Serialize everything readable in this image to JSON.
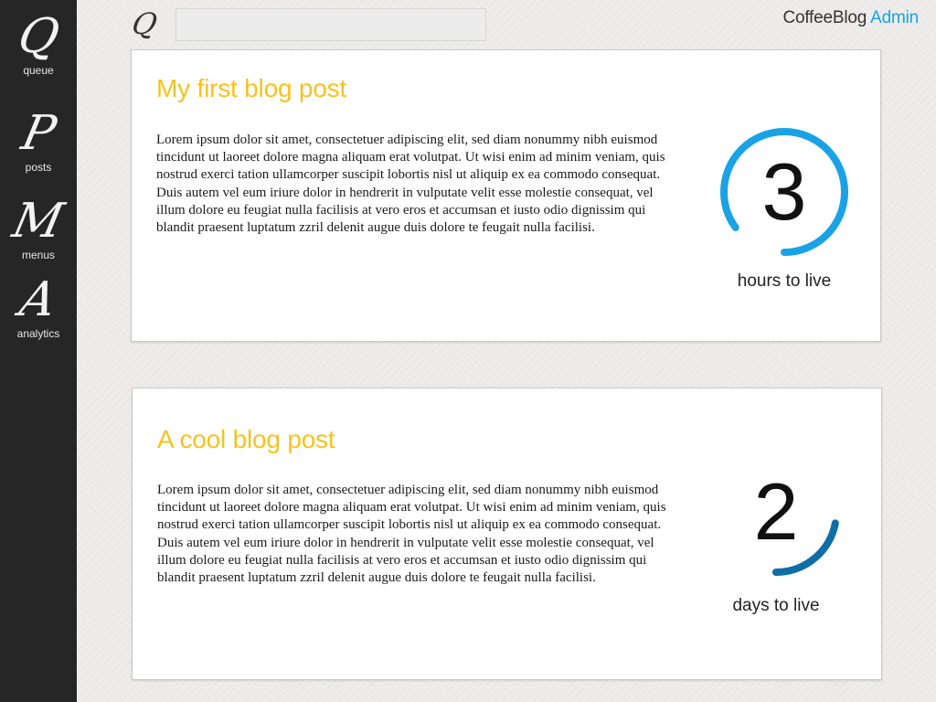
{
  "sidebar": {
    "items": [
      {
        "glyph": "Q",
        "label": "queue"
      },
      {
        "glyph": "P",
        "label": "posts"
      },
      {
        "glyph": "M",
        "label": "menus"
      },
      {
        "glyph": "A",
        "label": "analytics"
      }
    ]
  },
  "header": {
    "search_icon_glyph": "Q",
    "search_value": "",
    "brand_name": "CoffeeBlog",
    "brand_role": "Admin"
  },
  "posts": [
    {
      "title": "My first blog post",
      "body": "Lorem ipsum dolor sit amet, consectetuer adipiscing elit, sed diam nonummy nibh euismod tincidunt ut laoreet dolore magna aliquam erat volutpat. Ut wisi enim ad minim veniam, quis nostrud exerci tation ullamcorper suscipit lobortis nisl ut aliquip ex ea commodo consequat. Duis autem vel eum iriure dolor in hendrerit in vulputate velit esse molestie consequat, vel illum dolore eu feugiat nulla facilisis at vero eros et accumsan et iusto odio dignissim qui blandit praesent luptatum zzril delenit augue duis dolore te feugait nulla facilisi.",
      "countdown_value": "3",
      "countdown_caption": "hours to live",
      "ring_fraction": 0.85,
      "ring_color": "#1aa2e6"
    },
    {
      "title": "A cool blog post",
      "body": "Lorem ipsum dolor sit amet, consectetuer adipiscing elit, sed diam nonummy nibh euismod tincidunt ut laoreet dolore magna aliquam erat volutpat. Ut wisi enim ad minim veniam, quis nostrud exerci tation ullamcorper suscipit lobortis nisl ut aliquip ex ea commodo consequat. Duis autem vel eum iriure dolor in hendrerit in vulputate velit esse molestie consequat, vel illum dolore eu feugiat nulla facilisis at vero eros et accumsan et iusto odio dignissim qui blandit praesent luptatum zzril delenit augue duis dolore te feugait nulla facilisi.",
      "countdown_value": "2",
      "countdown_caption": "days to live",
      "ring_fraction": 0.22,
      "ring_color": "#0f6ea6"
    }
  ],
  "colors": {
    "sidebar_bg": "#262626",
    "title_accent": "#f6c21e",
    "brand_accent": "#1aa2e6"
  }
}
